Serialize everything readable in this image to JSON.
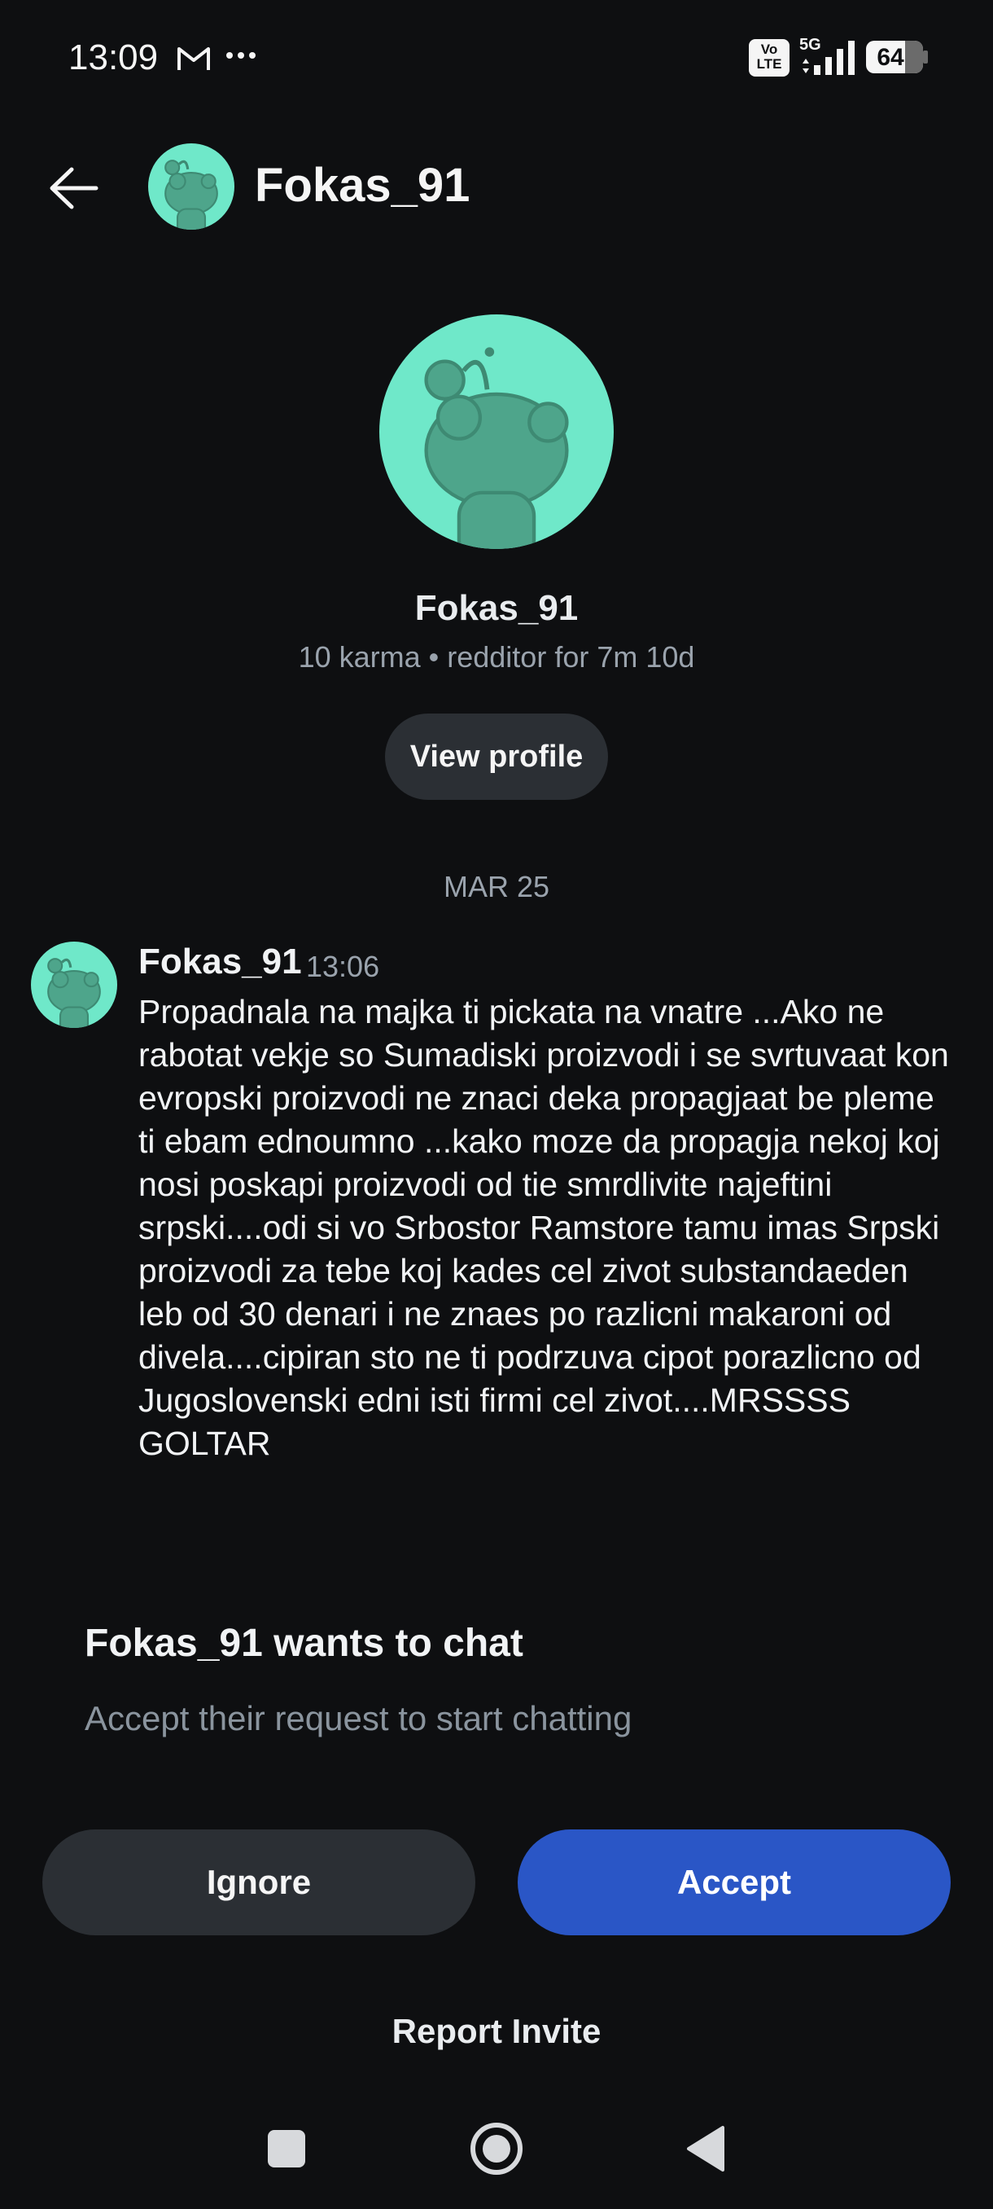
{
  "status_bar": {
    "time": "13:09",
    "notification_icons": [
      "gmail-icon",
      "more-dots-icon"
    ],
    "volte_label": "Vo\nLTE",
    "network_label": "5G",
    "battery_percent": "64"
  },
  "header": {
    "back_icon": "arrow-left-icon",
    "username": "Fokas_91"
  },
  "profile": {
    "username": "Fokas_91",
    "stats": "10 karma • redditor for 7m 10d",
    "view_profile_label": "View profile"
  },
  "thread": {
    "date_separator": "MAR 25",
    "message": {
      "author": "Fokas_91",
      "time": "13:06",
      "text": "Propadnala na majka ti pickata na vnatre ...Ako ne rabotat vekje so Sumadiski proizvodi i se svrtuvaat kon  evropski proizvodi ne znaci deka propagjaat be pleme ti ebam ednoumno ...kako moze da propagja nekoj koj nosi poskapi proizvodi od tie smrdlivite najeftini srpski....odi si vo Srbostor Ramstore tamu imas Srpski proizvodi za tebe koj kades cel zivot substandaeden leb od 30 denari  i ne znaes po razlicni makaroni od divela....cipiran sto ne ti podrzuva cipot porazlicno od Jugoslovenski edni isti firmi cel zivot....MRSSSS GOLTAR"
    }
  },
  "chat_request": {
    "title": "Fokas_91 wants to chat",
    "subtitle": "Accept their request to start chatting",
    "ignore_label": "Ignore",
    "accept_label": "Accept",
    "report_label": "Report Invite"
  },
  "nav_bar": {
    "buttons": [
      "recents-square-icon",
      "home-circle-icon",
      "back-triangle-icon"
    ]
  },
  "colors": {
    "background": "#0e0f11",
    "avatar_bg": "#6fe8c9",
    "avatar_fg": "#4ea58b",
    "accent": "#2a56c6",
    "secondary_button": "#2b2f34",
    "muted_text": "#9aa3ad"
  }
}
